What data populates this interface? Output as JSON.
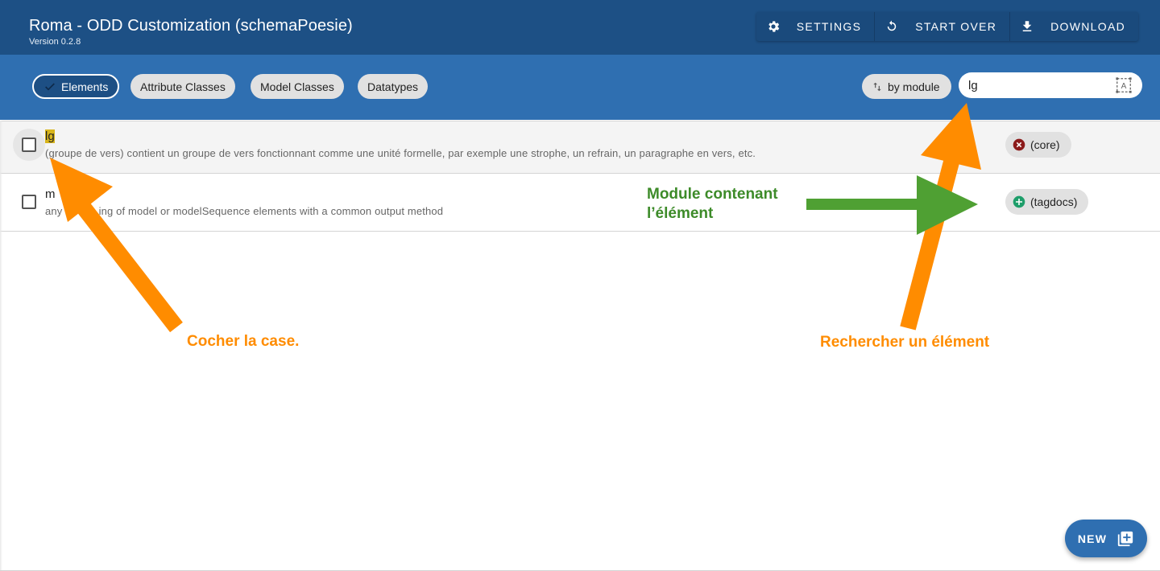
{
  "app": {
    "title": "Roma - ODD Customization (schemaPoesie)",
    "version": "Version 0.2.8"
  },
  "toolbar": {
    "settings_label": "SETTINGS",
    "start_over_label": "START OVER",
    "download_label": "DOWNLOAD"
  },
  "filters": {
    "tabs": [
      {
        "label": "Elements",
        "active": true
      },
      {
        "label": "Attribute Classes",
        "active": false
      },
      {
        "label": "Model Classes",
        "active": false
      },
      {
        "label": "Datatypes",
        "active": false
      }
    ],
    "sort_label": "by module"
  },
  "search": {
    "value": "lg"
  },
  "elements": [
    {
      "name": "lg",
      "description": "(groupe de vers) contient un groupe de vers fonctionnant comme une unité formelle, par exemple une strophe, un refrain, un paragraphe en vers, etc.",
      "module": "(core)",
      "module_status": "included"
    },
    {
      "name": "m",
      "description": "any g",
      "description_rest": "ing of model or modelSequence elements with a common output method",
      "module": "(tagdocs)",
      "module_status": "excluded"
    }
  ],
  "fab": {
    "label": "NEW"
  },
  "annotations": {
    "checkbox_hint": "Cocher la case.",
    "search_hint": "Rechercher un élément",
    "module_hint_line1": "Module contenant",
    "module_hint_line2": "l’élément"
  },
  "colors": {
    "appbar": "#1d5085",
    "filterbar": "#2f6fb1",
    "highlight": "#d8b51b",
    "annotation_orange": "#ff8c00",
    "annotation_green": "#4fa033",
    "remove_icon": "#8b1a1a",
    "add_icon": "#1e9e6a"
  }
}
